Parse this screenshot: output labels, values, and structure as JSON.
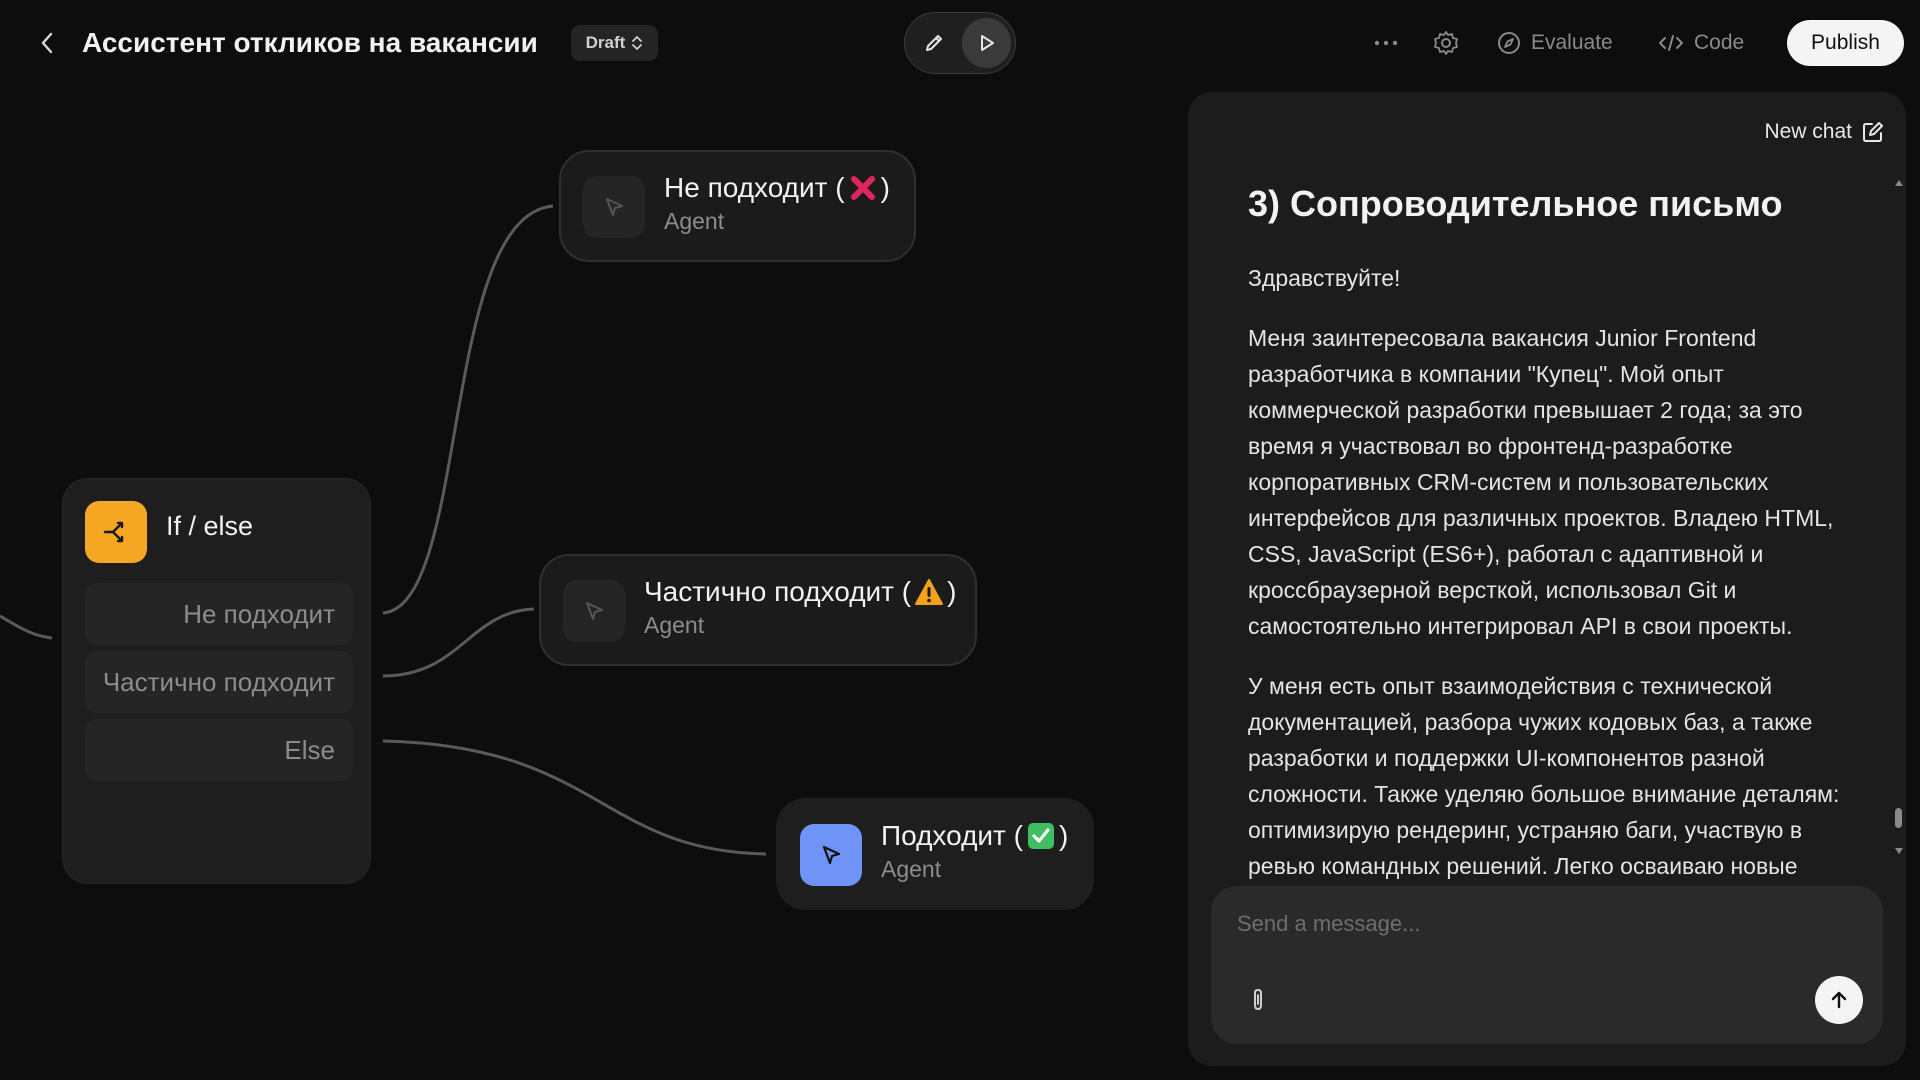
{
  "header": {
    "title": "Ассистент откликов на вакансии",
    "badge": "Draft",
    "more_label": "···",
    "evaluate_label": "Evaluate",
    "code_label": "Code",
    "publish_label": "Publish"
  },
  "icons": {
    "back": "chevron-left-icon",
    "badge_toggle": "chevron-up-down-icon",
    "edit": "pencil-icon",
    "preview": "play-icon",
    "more": "ellipsis-icon",
    "settings": "gear-icon",
    "evaluate": "compass-icon",
    "code": "code-icon",
    "ifelse": "branch-icon",
    "agent": "cursor-arrow-icon",
    "new_chat": "compose-icon",
    "attach": "paperclip-icon",
    "send": "arrow-up-icon"
  },
  "colors": {
    "ifelse_accent": "#f5a623",
    "agent_success_accent": "#6f93f7",
    "cross_emoji": "#e0245e",
    "warning_emoji": "#f4a21b",
    "check_emoji": "#3fbf5f"
  },
  "canvas": {
    "ifelse": {
      "title": "If / else",
      "conditions": [
        "Не подходит",
        "Частично подходит",
        "Else"
      ]
    },
    "agents": [
      {
        "title_prefix": "Не подходит (",
        "emoji": "cross",
        "title_suffix": ")",
        "subtitle": "Agent"
      },
      {
        "title_prefix": "Частично подходит (",
        "emoji": "warning",
        "title_suffix": ")",
        "subtitle": "Agent"
      },
      {
        "title_prefix": "Подходит (",
        "emoji": "check",
        "title_suffix": ")",
        "subtitle": "Agent"
      }
    ]
  },
  "chat": {
    "new_chat_label": "New chat",
    "heading": "3) Сопроводительное письмо",
    "paragraphs": [
      "Здравствуйте!",
      "Меня заинтересовала вакансия Junior Frontend разработчика в компании \"Купец\". Мой опыт коммерческой разработки превышает 2 года; за это время я участвовал во фронтенд-разработке корпоративных CRM-систем и пользовательских интерфейсов для различных проектов. Владею HTML, CSS, JavaScript (ES6+), работал с адаптивной и кроссбраузерной версткой, использовал Git и самостоятельно интегрировал API в свои проекты.",
      "У меня есть опыт взаимодействия с технической документацией, разбора чужих кодовых баз, а также разработки и поддержки UI-компонентов разной сложности. Также уделяю большое внимание деталям: оптимизирую рендеринг, устраняю баги, участвую в ревью командных решений. Легко осваиваю новые"
    ],
    "composer_placeholder": "Send a message..."
  }
}
